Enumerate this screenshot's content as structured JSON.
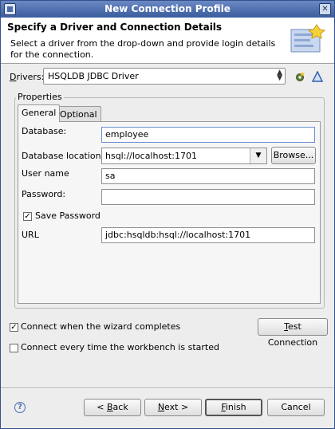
{
  "window": {
    "title": "New Connection Profile"
  },
  "header": {
    "title": "Specify a Driver and Connection Details",
    "description": "Select a driver from the drop-down and provide login details for the connection."
  },
  "drivers": {
    "label_pre": "D",
    "label_post": "rivers:",
    "value": "HSQLDB JDBC Driver"
  },
  "properties": {
    "group_label": "Properties",
    "tabs": [
      {
        "label": "General",
        "active": true
      },
      {
        "label": "Optional",
        "active": false
      }
    ]
  },
  "fields": {
    "database_label": "Database:",
    "database_value": "employee",
    "location_label": "Database location:",
    "location_value": "hsql://localhost:1701",
    "browse_label": "Browse...",
    "user_label": "User name",
    "user_value": "sa",
    "password_label": "Password:",
    "password_value": "",
    "save_password_label": "Save Password",
    "save_password_checked": true,
    "url_label": "URL",
    "url_value": "jdbc:hsqldb:hsql://localhost:1701"
  },
  "options": {
    "connect_wizard_label": "Connect when the wizard completes",
    "connect_wizard_checked": true,
    "connect_startup_label": "Connect every time the workbench is started",
    "connect_startup_checked": false,
    "test_connection_pre": "",
    "test_connection_u": "T",
    "test_connection_post": "est Connection"
  },
  "footer": {
    "back_pre": "< ",
    "back_u": "B",
    "back_post": "ack",
    "next_u": "N",
    "next_post": "ext >",
    "finish_u": "F",
    "finish_post": "inish",
    "cancel_label": "Cancel"
  },
  "icons": {
    "help": "help-icon",
    "new_driver": "new-driver-icon",
    "edit_driver": "edit-driver-icon",
    "header_image": "connection-wizard-banner-icon"
  },
  "colors": {
    "titlebar": "#3a5c9d",
    "accent": "#4a6db0"
  }
}
